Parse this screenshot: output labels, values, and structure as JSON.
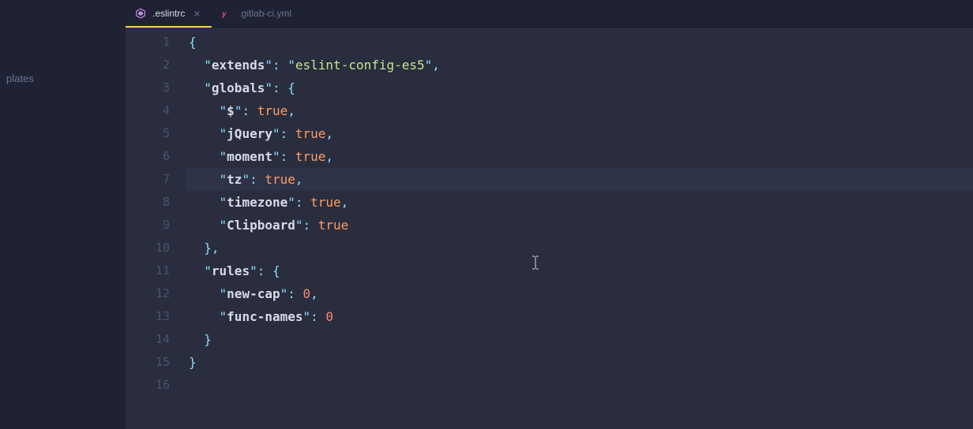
{
  "sidebar": {
    "item0": "plates"
  },
  "tabs": {
    "t0": {
      "label": ".eslintrc"
    },
    "t1": {
      "label": ".gitlab-ci.yml"
    }
  },
  "gutter": {
    "l1": "1",
    "l2": "2",
    "l3": "3",
    "l4": "4",
    "l5": "5",
    "l6": "6",
    "l7": "7",
    "l8": "8",
    "l9": "9",
    "l10": "10",
    "l11": "11",
    "l12": "12",
    "l13": "13",
    "l14": "14",
    "l15": "15",
    "l16": "16"
  },
  "code": {
    "bo": "{",
    "bc": "}",
    "bo2": "{",
    "bc2": "}",
    "colon": ": ",
    "comma": ",",
    "q": "\"",
    "k_extends": "extends",
    "v_extends": "eslint-config-es5",
    "k_globals": "globals",
    "k_dollar": "$",
    "k_jquery": "jQuery",
    "k_moment": "moment",
    "k_tz": "tz",
    "k_timezone": "timezone",
    "k_clipboard": "Clipboard",
    "v_true": "true",
    "k_rules": "rules",
    "k_newcap": "new-cap",
    "k_funcnames": "func-names",
    "v_zero": "0",
    "indent1": "  ",
    "indent2": "    "
  },
  "close_glyph": "×"
}
